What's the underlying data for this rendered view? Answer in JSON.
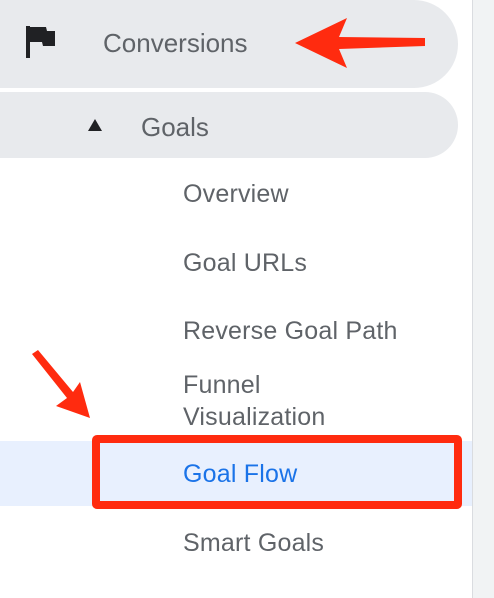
{
  "nav": {
    "conversions": {
      "label": "Conversions",
      "icon": "flag-icon"
    },
    "goals": {
      "label": "Goals",
      "icon": "triangle-up-icon",
      "expanded": true,
      "items": [
        {
          "label": "Overview",
          "active": false
        },
        {
          "label": "Goal URLs",
          "active": false
        },
        {
          "label": "Reverse Goal Path",
          "active": false
        },
        {
          "label": "Funnel Visualization",
          "active": false
        },
        {
          "label": "Goal Flow",
          "active": true
        },
        {
          "label": "Smart Goals",
          "active": false
        }
      ]
    }
  },
  "annotations": {
    "arrow_color": "#ff2b0f",
    "highlight_color": "#ff2b0f",
    "highlighted_item": "Goal Flow"
  },
  "colors": {
    "section_bg": "#e8eaed",
    "text": "#5f6368",
    "active_text": "#1a73e8",
    "active_bg": "#e8f0fe"
  }
}
